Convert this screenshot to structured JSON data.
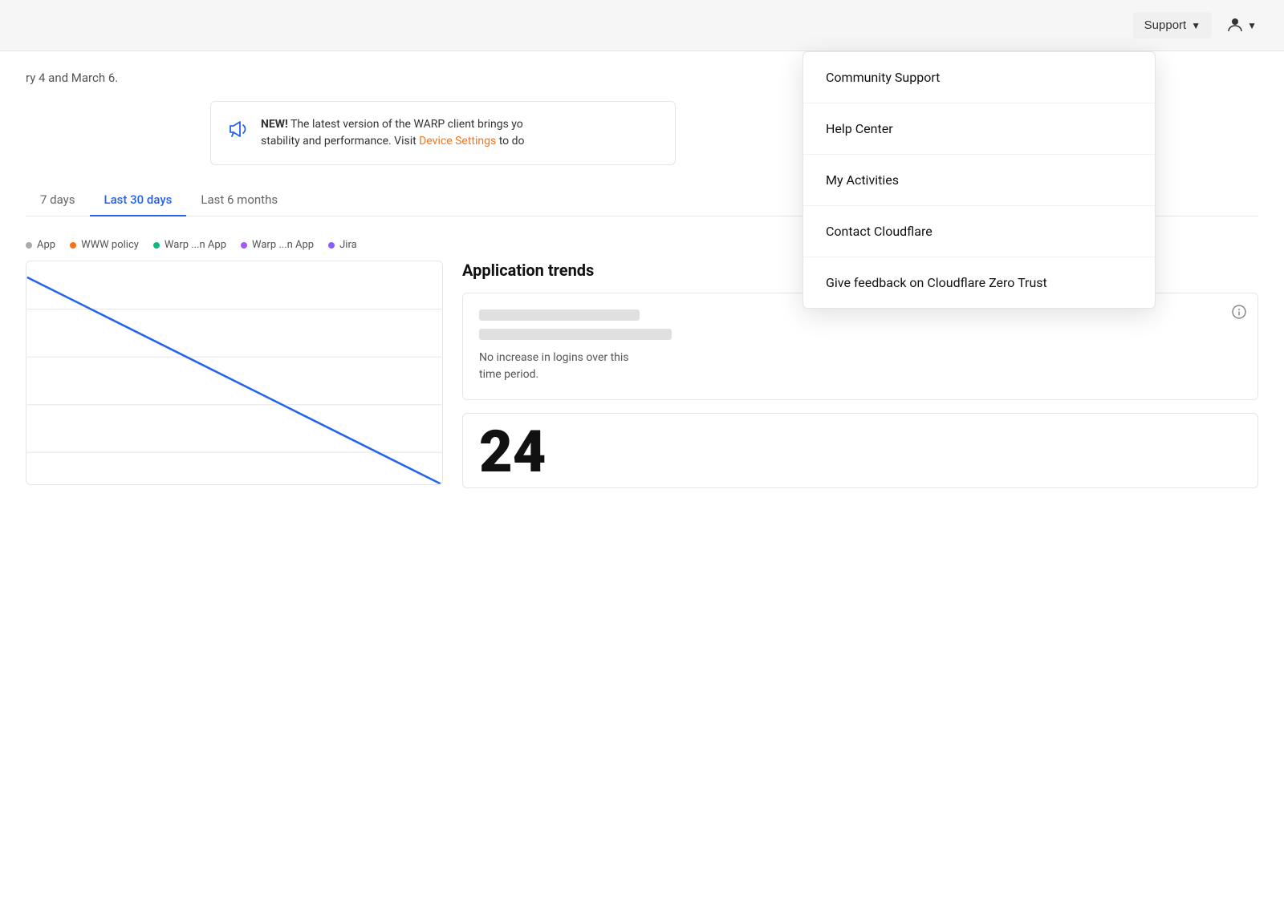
{
  "header": {
    "support_label": "Support",
    "support_chevron": "▼",
    "user_icon": "👤",
    "user_chevron": "▼"
  },
  "dropdown": {
    "items": [
      {
        "id": "community-support",
        "label": "Community Support"
      },
      {
        "id": "help-center",
        "label": "Help Center"
      },
      {
        "id": "my-activities",
        "label": "My Activities"
      },
      {
        "id": "contact-cloudflare",
        "label": "Contact Cloudflare"
      },
      {
        "id": "give-feedback",
        "label": "Give feedback on Cloudflare Zero Trust"
      }
    ]
  },
  "date_range_text": "ry 4 and March 6.",
  "notification": {
    "bold_label": "NEW!",
    "text": " The latest version of the WARP client brings yo",
    "text2": "stability and performance. Visit ",
    "link_label": "Device Settings",
    "text3": " to do",
    "suffix": "..."
  },
  "time_tabs": [
    {
      "id": "7days",
      "label": "7 days",
      "active": false
    },
    {
      "id": "30days",
      "label": "Last 30 days",
      "active": true
    },
    {
      "id": "6months",
      "label": "Last 6 months",
      "active": false
    }
  ],
  "legend": [
    {
      "id": "app",
      "label": "App",
      "color": "#aaa"
    },
    {
      "id": "www-policy",
      "label": "WWW policy",
      "color": "#f97316"
    },
    {
      "id": "warp-app-1",
      "label": "Warp ...n App",
      "color": "#10b981"
    },
    {
      "id": "warp-app-2",
      "label": "Warp ...n App",
      "color": "#a855f7"
    },
    {
      "id": "jira",
      "label": "Jira",
      "color": "#8b5cf6"
    }
  ],
  "app_trends": {
    "title": "Application trends",
    "no_increase_text": "No increase in logins over this\ntime period.",
    "big_number": "24"
  },
  "colors": {
    "accent_blue": "#2563eb",
    "line_blue": "#2563eb"
  }
}
